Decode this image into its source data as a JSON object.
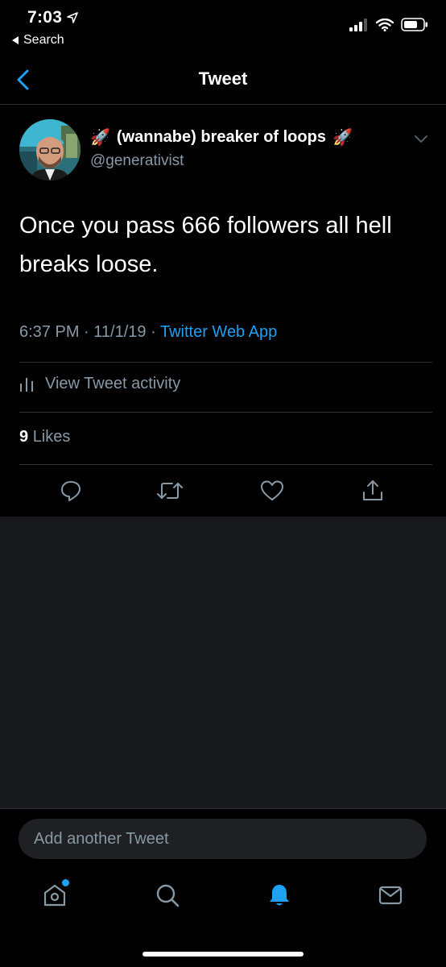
{
  "status_bar": {
    "time": "7:03",
    "back_app_label": "Search"
  },
  "nav": {
    "title": "Tweet"
  },
  "tweet": {
    "display_name": "(wannabe) breaker of loops",
    "name_emoji": "🚀",
    "handle": "@generativist",
    "text": "Once you pass 666 followers all hell breaks loose.",
    "time": "6:37 PM",
    "date": "11/1/19",
    "separator": "·",
    "source": "Twitter Web App",
    "activity_label": "View Tweet activity",
    "likes_count": "9",
    "likes_label": "Likes"
  },
  "compose": {
    "placeholder": "Add another Tweet"
  },
  "icons": {
    "reply": "reply-icon",
    "retweet": "retweet-icon",
    "like": "heart-icon",
    "share": "share-icon",
    "home": "home-icon",
    "search": "search-icon",
    "notifications": "bell-icon",
    "messages": "mail-icon"
  },
  "colors": {
    "accent": "#1da1f2",
    "muted": "#8899a6",
    "background": "#000000",
    "empty_area": "#18191d"
  }
}
